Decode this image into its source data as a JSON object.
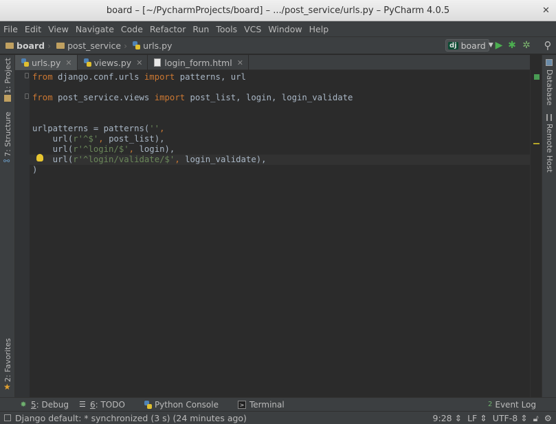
{
  "window": {
    "title": "board – [~/PycharmProjects/board] – .../post_service/urls.py – PyCharm 4.0.5"
  },
  "menu": [
    "File",
    "Edit",
    "View",
    "Navigate",
    "Code",
    "Refactor",
    "Run",
    "Tools",
    "VCS",
    "Window",
    "Help"
  ],
  "breadcrumbs": [
    "board",
    "post_service",
    "urls.py"
  ],
  "run_config": {
    "badge": "dj",
    "label": "board"
  },
  "tabs": [
    {
      "label": "urls.py",
      "active": true
    },
    {
      "label": "views.py",
      "active": false
    },
    {
      "label": "login_form.html",
      "active": false
    }
  ],
  "left_tools": [
    "1: Project",
    "7: Structure",
    "2: Favorites"
  ],
  "right_tools": [
    "Database",
    "Remote Host"
  ],
  "code": [
    [
      {
        "t": "from",
        "c": "kw"
      },
      {
        "t": " django.conf.urls ",
        "c": "id"
      },
      {
        "t": "import",
        "c": "kw"
      },
      {
        "t": " patterns, url",
        "c": "id"
      }
    ],
    [],
    [
      {
        "t": "from",
        "c": "kw"
      },
      {
        "t": " post_service.views ",
        "c": "id"
      },
      {
        "t": "import",
        "c": "kw"
      },
      {
        "t": " post_list, login, login_validate",
        "c": "id"
      }
    ],
    [],
    [],
    [
      {
        "t": "urlpatterns = patterns(",
        "c": "id"
      },
      {
        "t": "''",
        "c": "str"
      },
      {
        "t": ",",
        "c": "kw"
      }
    ],
    [
      {
        "t": "    url(",
        "c": "id"
      },
      {
        "t": "r'^$'",
        "c": "str"
      },
      {
        "t": ", ",
        "c": "kw"
      },
      {
        "t": "post_list),",
        "c": "id"
      }
    ],
    [
      {
        "t": "    url(",
        "c": "id"
      },
      {
        "t": "r'^login/$'",
        "c": "str"
      },
      {
        "t": ", ",
        "c": "kw"
      },
      {
        "t": "login),",
        "c": "id"
      }
    ],
    [
      {
        "t": "    url(",
        "c": "id"
      },
      {
        "t": "r'^login/validate/$'",
        "c": "str"
      },
      {
        "t": ", ",
        "c": "kw"
      },
      {
        "t": "login_validate),",
        "c": "id"
      }
    ],
    [
      {
        "t": ")",
        "c": "id"
      }
    ]
  ],
  "tool_windows": [
    {
      "key": "5",
      "label": ": Debug"
    },
    {
      "key": "6",
      "label": ": TODO"
    },
    {
      "key": "",
      "label": "Python Console"
    },
    {
      "key": "",
      "label": "Terminal"
    }
  ],
  "event_log": "Event Log",
  "event_count": "2",
  "status": {
    "message": "Django default: * synchronized (3 s) (24 minutes ago)",
    "position": "9:28",
    "line_sep": "LF",
    "encoding": "UTF-8"
  }
}
